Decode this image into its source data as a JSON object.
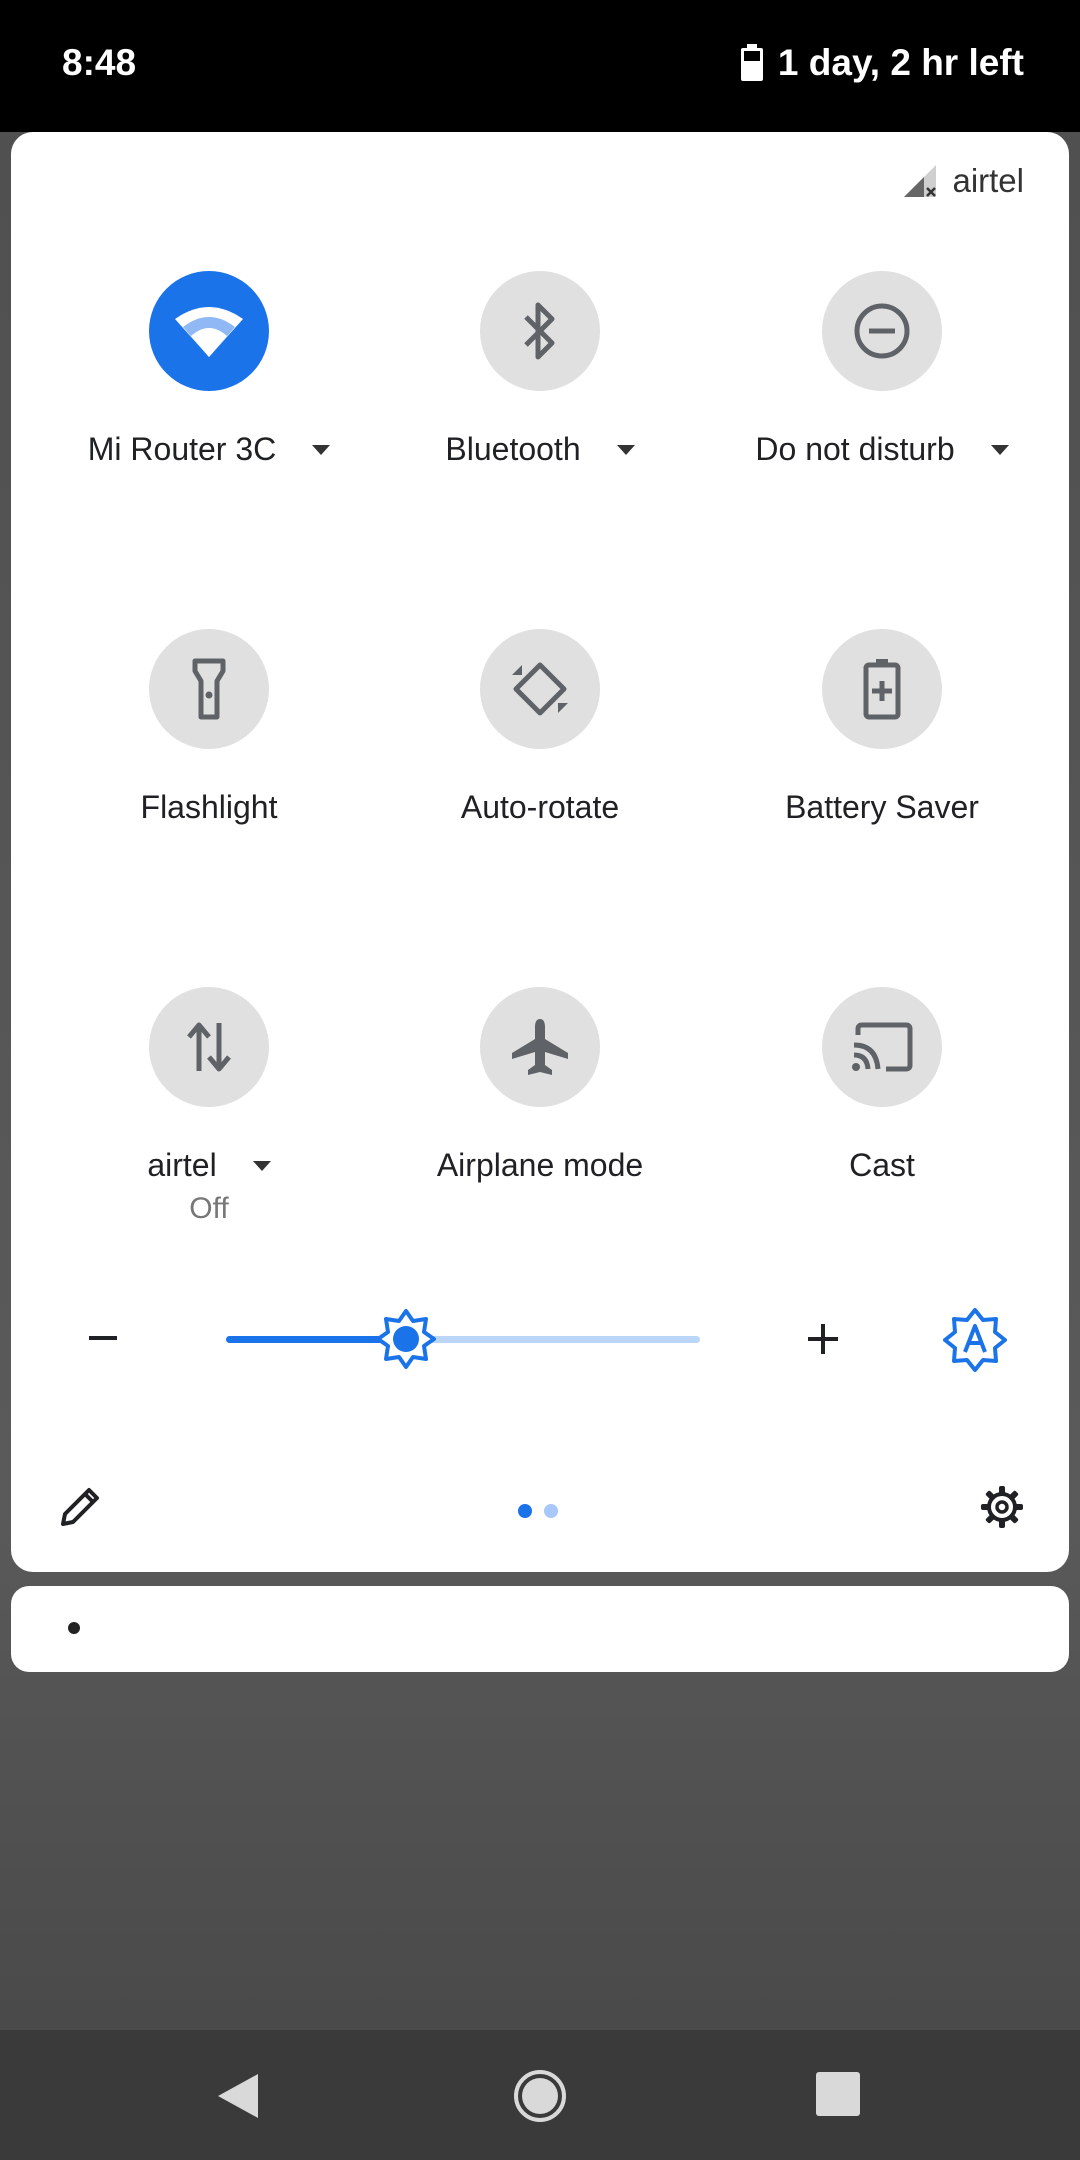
{
  "status_bar": {
    "time": "8:48",
    "battery_text": "1 day, 2 hr left"
  },
  "carrier": {
    "name": "airtel"
  },
  "tiles": [
    {
      "label": "Mi Router 3C",
      "icon": "wifi-icon",
      "active": true,
      "has_dropdown": true
    },
    {
      "label": "Bluetooth",
      "icon": "bluetooth-icon",
      "active": false,
      "has_dropdown": true
    },
    {
      "label": "Do not disturb",
      "icon": "do-not-disturb-icon",
      "active": false,
      "has_dropdown": true
    },
    {
      "label": "Flashlight",
      "icon": "flashlight-icon",
      "active": false
    },
    {
      "label": "Auto-rotate",
      "icon": "auto-rotate-icon",
      "active": false
    },
    {
      "label": "Battery Saver",
      "icon": "battery-saver-icon",
      "active": false
    },
    {
      "label": "airtel",
      "sublabel": "Off",
      "icon": "mobile-data-icon",
      "active": false,
      "has_dropdown": true
    },
    {
      "label": "Airplane mode",
      "icon": "airplane-icon",
      "active": false
    },
    {
      "label": "Cast",
      "icon": "cast-icon",
      "active": false
    }
  ],
  "brightness": {
    "level": 0.38,
    "auto_icon": "auto-brightness-icon"
  },
  "pager": {
    "pages": 2,
    "current": 1
  },
  "colors": {
    "accent": "#1a73e8",
    "tile_inactive": "#e0e0e0"
  }
}
